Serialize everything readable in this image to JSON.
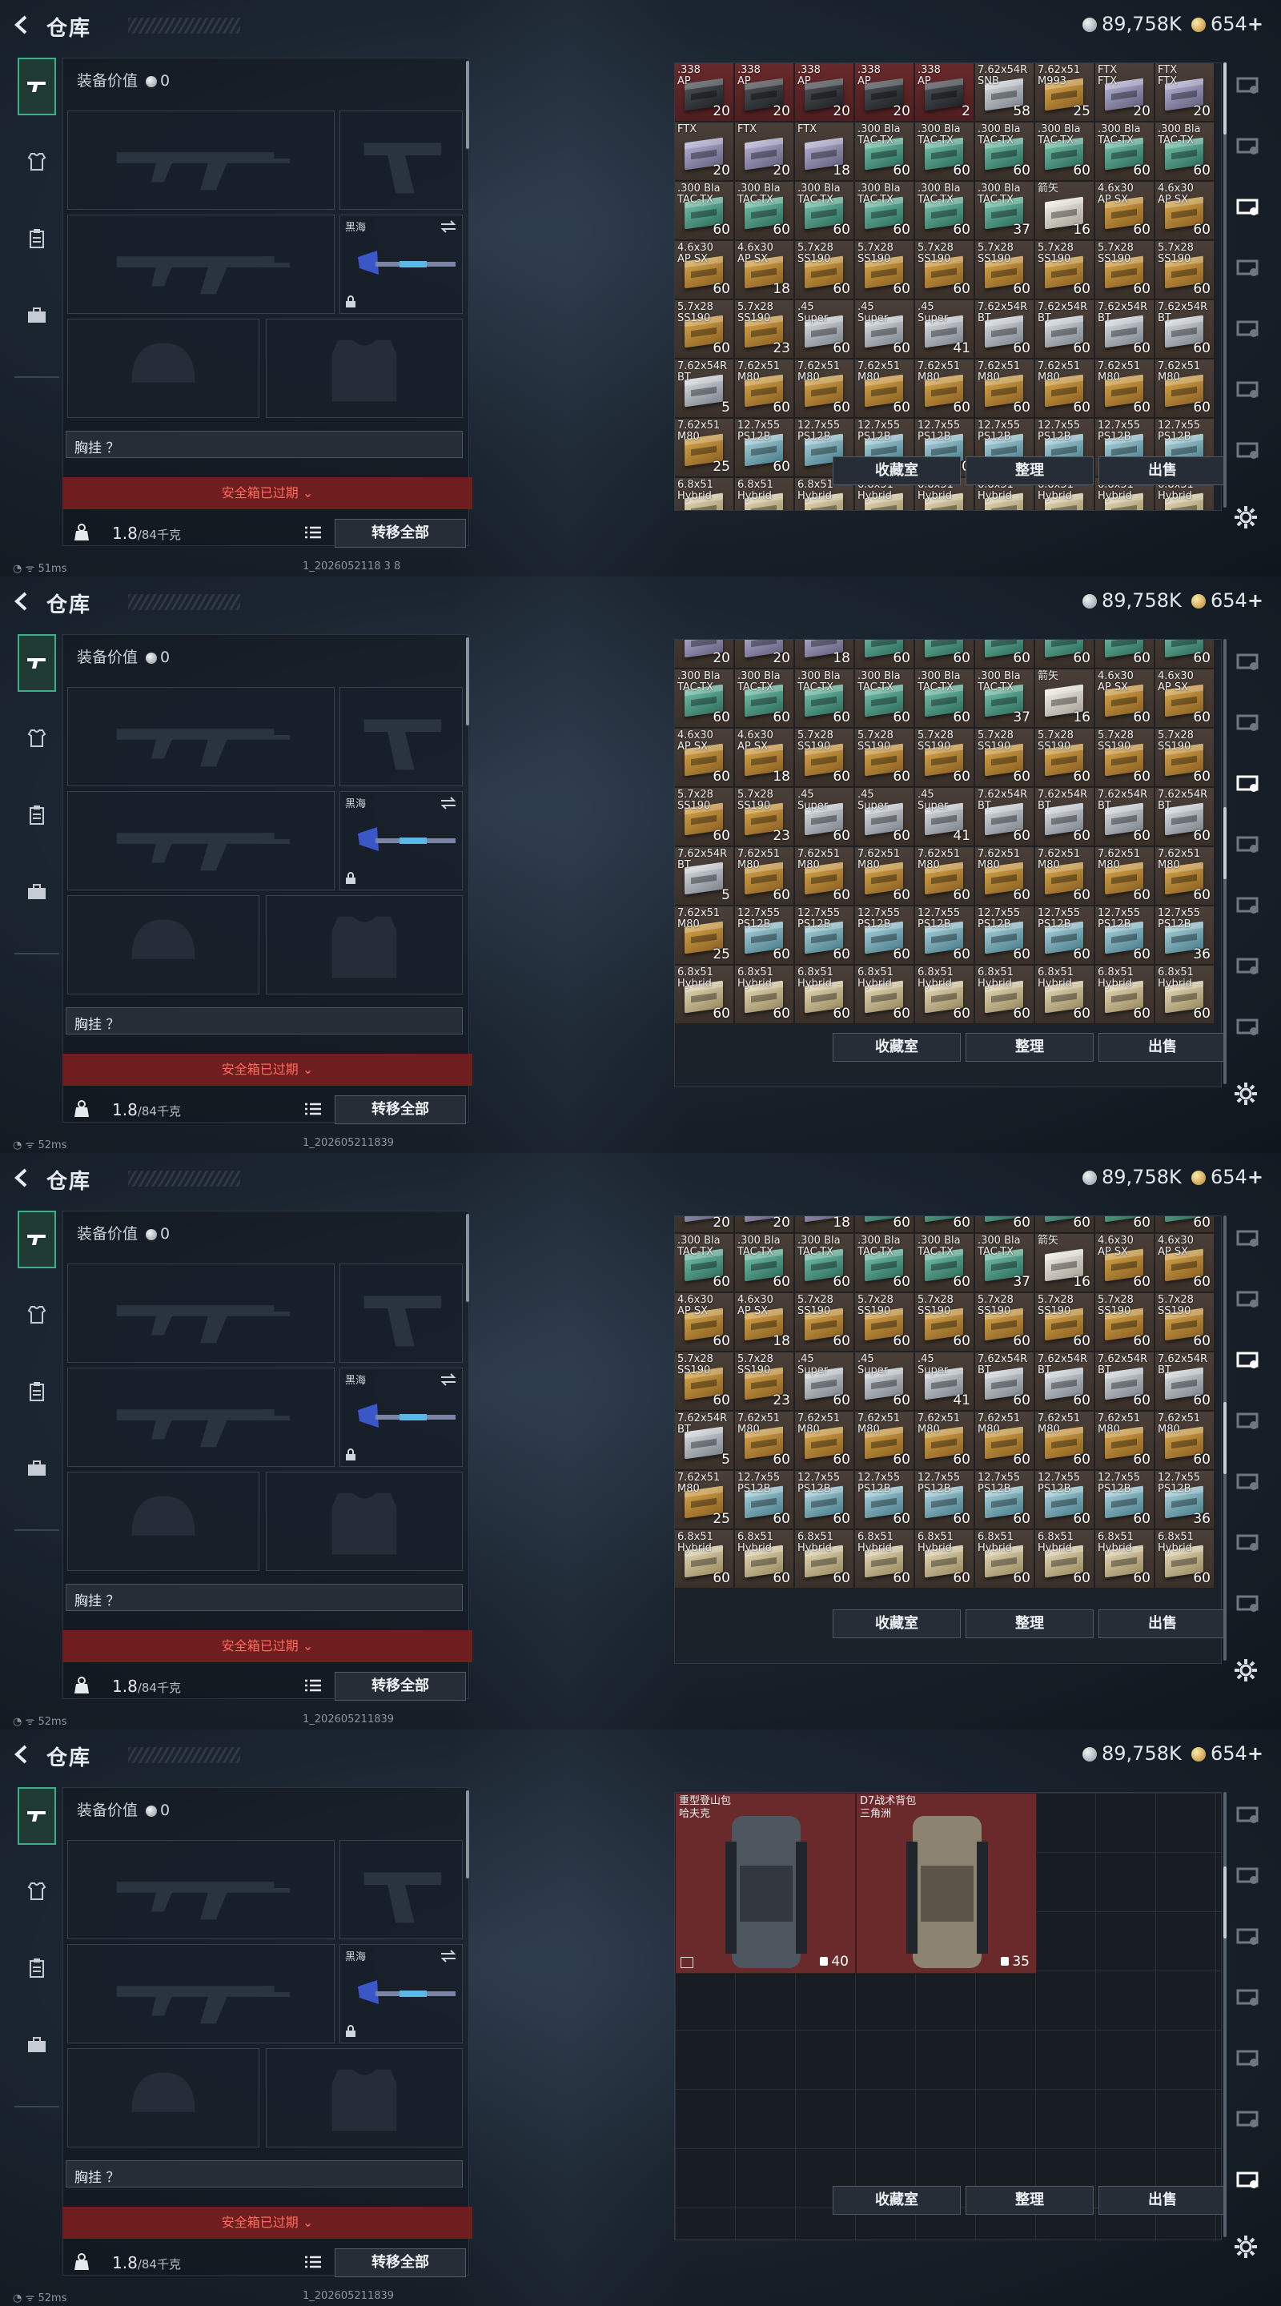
{
  "header": {
    "title": "仓库",
    "silver": "89,758K",
    "gold": "654",
    "gold_plus": "+"
  },
  "equipment": {
    "value_label": "装备价值",
    "value": "0",
    "slots": {
      "melee": "黑海"
    },
    "chest_rig": "胸挂 ？",
    "safebox_expired": "安全箱已过期",
    "weight": "1.8",
    "weight_unit": "/84千克",
    "transfer_all": "转移全部"
  },
  "actions": {
    "collection": "收藏室",
    "sort": "整理",
    "sell": "出售"
  },
  "icons": {
    "left_nav": [
      "gun-icon",
      "armor-icon",
      "clipboard-icon",
      "briefcase-icon"
    ],
    "right_nav": [
      "helmet-tab-icon",
      "weapon-tab-icon",
      "chest-tab-icon",
      "case-tab-icon",
      "gear-tab-icon",
      "misc-tab-icon",
      "key-tab-icon"
    ]
  },
  "panels": [
    {
      "ping": "51ms",
      "version": "1_2026052118 3 8",
      "first_row_offset": 0,
      "scroll_fraction": 0.0,
      "active_right_tab": 2,
      "cells": [
        {
          "n": ".338\nAP",
          "c": "20",
          "k": "dark",
          "r": true
        },
        {
          "n": ".338\nAP",
          "c": "20",
          "k": "dark",
          "r": true
        },
        {
          "n": ".338\nAP",
          "c": "20",
          "k": "dark",
          "r": true
        },
        {
          "n": ".338\nAP",
          "c": "20",
          "k": "dark",
          "r": true
        },
        {
          "n": ".338\nAP",
          "c": "2",
          "k": "dark",
          "r": true
        },
        {
          "n": "7.62x54R\nSNB",
          "c": "58",
          "k": "silver"
        },
        {
          "n": "7.62x51\nM993",
          "c": "25",
          "k": "gold"
        },
        {
          "n": "FTX\nFTX",
          "c": "20",
          "k": "lav"
        },
        {
          "n": "FTX\nFTX",
          "c": "20",
          "k": "lav"
        },
        {
          "n": "FTX",
          "c": "20",
          "k": "lav"
        },
        {
          "n": "FTX",
          "c": "20",
          "k": "lav"
        },
        {
          "n": "FTX",
          "c": "18",
          "k": "lav"
        },
        {
          "n": ".300 Bla\nTAC-TX",
          "c": "60",
          "k": "teal"
        },
        {
          "n": ".300 Bla\nTAC-TX",
          "c": "60",
          "k": "teal"
        },
        {
          "n": ".300 Bla\nTAC-TX",
          "c": "60",
          "k": "teal"
        },
        {
          "n": ".300 Bla\nTAC-TX",
          "c": "60",
          "k": "teal"
        },
        {
          "n": ".300 Bla\nTAC-TX",
          "c": "60",
          "k": "teal"
        },
        {
          "n": ".300 Bla\nTAC-TX",
          "c": "60",
          "k": "teal"
        },
        {
          "n": ".300 Bla\nTAC-TX",
          "c": "60",
          "k": "teal"
        },
        {
          "n": ".300 Bla\nTAC-TX",
          "c": "60",
          "k": "teal"
        },
        {
          "n": ".300 Bla\nTAC-TX",
          "c": "60",
          "k": "teal"
        },
        {
          "n": ".300 Bla\nTAC-TX",
          "c": "60",
          "k": "teal"
        },
        {
          "n": ".300 Bla\nTAC-TX",
          "c": "60",
          "k": "teal"
        },
        {
          "n": ".300 Bla\nTAC-TX",
          "c": "37",
          "k": "teal"
        },
        {
          "n": "箭矢",
          "c": "16",
          "k": "cream"
        },
        {
          "n": "4.6x30\nAP SX",
          "c": "60",
          "k": "gold"
        },
        {
          "n": "4.6x30\nAP SX",
          "c": "60",
          "k": "gold"
        },
        {
          "n": "4.6x30\nAP SX",
          "c": "60",
          "k": "gold"
        },
        {
          "n": "4.6x30\nAP SX",
          "c": "18",
          "k": "gold"
        },
        {
          "n": "5.7x28\nSS190",
          "c": "60",
          "k": "gold"
        },
        {
          "n": "5.7x28\nSS190",
          "c": "60",
          "k": "gold"
        },
        {
          "n": "5.7x28\nSS190",
          "c": "60",
          "k": "gold"
        },
        {
          "n": "5.7x28\nSS190",
          "c": "60",
          "k": "gold"
        },
        {
          "n": "5.7x28\nSS190",
          "c": "60",
          "k": "gold"
        },
        {
          "n": "5.7x28\nSS190",
          "c": "60",
          "k": "gold"
        },
        {
          "n": "5.7x28\nSS190",
          "c": "60",
          "k": "gold"
        },
        {
          "n": "5.7x28\nSS190",
          "c": "60",
          "k": "gold"
        },
        {
          "n": "5.7x28\nSS190",
          "c": "23",
          "k": "gold"
        },
        {
          "n": ".45\nSuper",
          "c": "60",
          "k": "silver"
        },
        {
          "n": ".45\nSuper",
          "c": "60",
          "k": "silver"
        },
        {
          "n": ".45\nSuper",
          "c": "41",
          "k": "silver"
        },
        {
          "n": "7.62x54R\nBT",
          "c": "60",
          "k": "silver"
        },
        {
          "n": "7.62x54R\nBT",
          "c": "60",
          "k": "silver"
        },
        {
          "n": "7.62x54R\nBT",
          "c": "60",
          "k": "silver"
        },
        {
          "n": "7.62x54R\nBT",
          "c": "60",
          "k": "silver"
        },
        {
          "n": "7.62x54R\nBT",
          "c": "5",
          "k": "silver"
        },
        {
          "n": "7.62x51\nM80",
          "c": "60",
          "k": "gold"
        },
        {
          "n": "7.62x51\nM80",
          "c": "60",
          "k": "gold"
        },
        {
          "n": "7.62x51\nM80",
          "c": "60",
          "k": "gold"
        },
        {
          "n": "7.62x51\nM80",
          "c": "60",
          "k": "gold"
        },
        {
          "n": "7.62x51\nM80",
          "c": "60",
          "k": "gold"
        },
        {
          "n": "7.62x51\nM80",
          "c": "60",
          "k": "gold"
        },
        {
          "n": "7.62x51\nM80",
          "c": "60",
          "k": "gold"
        },
        {
          "n": "7.62x51\nM80",
          "c": "60",
          "k": "gold"
        },
        {
          "n": "7.62x51\nM80",
          "c": "25",
          "k": "gold"
        },
        {
          "n": "12.7x55\nPS12B",
          "c": "60",
          "k": "cyan"
        },
        {
          "n": "12.7x55\nPS12B",
          "c": "60",
          "k": "cyan"
        },
        {
          "n": "12.7x55\nPS12B",
          "c": "60",
          "k": "cyan"
        },
        {
          "n": "12.7x55\nPS12B",
          "c": "60",
          "k": "cyan"
        },
        {
          "n": "12.7x55\nPS12B",
          "c": "60",
          "k": "cyan"
        },
        {
          "n": "12.7x55\nPS12B",
          "c": "60",
          "k": "cyan"
        },
        {
          "n": "12.7x55\nPS12B",
          "c": "60",
          "k": "cyan"
        },
        {
          "n": "12.7x55\nPS12B",
          "c": "36",
          "k": "cyan"
        },
        {
          "n": "6.8x51\nHybrid",
          "c": "60",
          "k": "tan"
        },
        {
          "n": "6.8x51\nHybrid",
          "c": "60",
          "k": "tan"
        },
        {
          "n": "6.8x51\nHybrid",
          "c": "60",
          "k": "tan"
        },
        {
          "n": "6.8x51\nHybrid",
          "c": "60",
          "k": "tan"
        },
        {
          "n": "6.8x51\nHybrid",
          "c": "60",
          "k": "tan"
        },
        {
          "n": "6.8x51\nHybrid",
          "c": "60",
          "k": "tan"
        },
        {
          "n": "6.8x51\nHybrid",
          "c": "60",
          "k": "tan"
        },
        {
          "n": "6.8x51\nHybrid",
          "c": "60",
          "k": "tan"
        },
        {
          "n": "6.8x51\nHybrid",
          "c": "60",
          "k": "tan"
        }
      ]
    },
    {
      "ping": "52ms",
      "version": "1_202605211839",
      "first_row_offset": -0.5,
      "scroll_fraction": 0.45,
      "active_right_tab": 2,
      "same_cells_from": 0
    },
    {
      "ping": "52ms",
      "version": "1_202605211839",
      "first_row_offset": -0.7,
      "scroll_fraction": 0.5,
      "active_right_tab": 2,
      "same_cells_from": 0
    },
    {
      "ping": "52ms",
      "version": "1_202605211839",
      "active_right_tab": 7,
      "backpacks": [
        {
          "name": "重型登山包\n哈夫克",
          "capacity": "40",
          "flag": true
        },
        {
          "name": "D7战术背包\n三角洲",
          "capacity": "35",
          "flag": false
        }
      ]
    }
  ]
}
